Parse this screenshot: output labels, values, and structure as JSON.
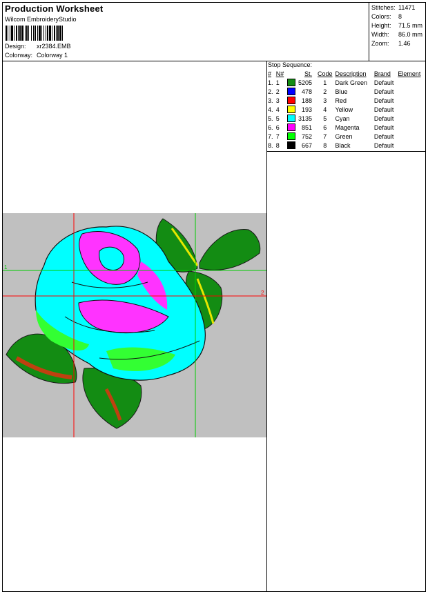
{
  "header": {
    "title": "Production Worksheet",
    "software": "Wilcom EmbroideryStudio",
    "design_label": "Design:",
    "design_value": "xr2384.EMB",
    "colorway_label": "Colorway:",
    "colorway_value": "Colorway 1"
  },
  "stats": {
    "stitches_label": "Stitches:",
    "stitches_value": "11471",
    "colors_label": "Colors:",
    "colors_value": "8",
    "height_label": "Height:",
    "height_value": "71.5 mm",
    "width_label": "Width:",
    "width_value": "86.0 mm",
    "zoom_label": "Zoom:",
    "zoom_value": "1.46"
  },
  "stop_sequence": {
    "title": "Stop Sequence:",
    "headers": [
      "#",
      "N#",
      "St.",
      "Code",
      "Description",
      "Brand",
      "Element"
    ],
    "rows": [
      {
        "num": "1.",
        "n": "1",
        "color": "#138c13",
        "st": "5205",
        "code": "1",
        "desc": "Dark Green",
        "brand": "Default"
      },
      {
        "num": "2.",
        "n": "2",
        "color": "#0000ff",
        "st": "478",
        "code": "2",
        "desc": "Blue",
        "brand": "Default"
      },
      {
        "num": "3.",
        "n": "3",
        "color": "#ff0000",
        "st": "188",
        "code": "3",
        "desc": "Red",
        "brand": "Default"
      },
      {
        "num": "4.",
        "n": "4",
        "color": "#ffff00",
        "st": "193",
        "code": "4",
        "desc": "Yellow",
        "brand": "Default"
      },
      {
        "num": "5.",
        "n": "5",
        "color": "#00ffff",
        "st": "3135",
        "code": "5",
        "desc": "Cyan",
        "brand": "Default"
      },
      {
        "num": "6.",
        "n": "6",
        "color": "#ff00ff",
        "st": "851",
        "code": "6",
        "desc": "Magenta",
        "brand": "Default"
      },
      {
        "num": "7.",
        "n": "7",
        "color": "#00ff00",
        "st": "752",
        "code": "7",
        "desc": "Green",
        "brand": "Default"
      },
      {
        "num": "8.",
        "n": "8",
        "color": "#000000",
        "st": "667",
        "code": "8",
        "desc": "Black",
        "brand": "Default"
      }
    ]
  },
  "preview": {
    "background": "#c0c0c0",
    "guide_label_1": "1",
    "guide_label_2": "2"
  }
}
